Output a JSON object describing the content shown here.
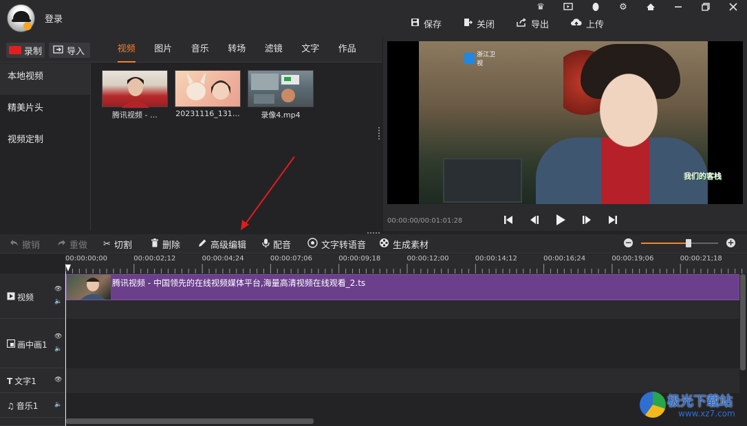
{
  "header": {
    "login_label": "登录",
    "window_controls": [
      "crown-icon",
      "play-screen-icon",
      "penguin-icon",
      "settings-icon",
      "home-icon",
      "minimize-icon",
      "restore-icon",
      "close-icon"
    ],
    "actions": [
      {
        "icon": "save-icon",
        "label": "保存"
      },
      {
        "icon": "exit-icon",
        "label": "关闭"
      },
      {
        "icon": "export-icon",
        "label": "导出"
      },
      {
        "icon": "cloud-upload-icon",
        "label": "上传"
      }
    ]
  },
  "library_bar": {
    "record_label": "录制",
    "import_label": "导入",
    "tabs": [
      "视频",
      "图片",
      "音乐",
      "转场",
      "滤镜",
      "文字",
      "作品"
    ],
    "active_tab": "视频"
  },
  "sidebar": {
    "items": [
      "本地视频",
      "精美片头",
      "视频定制"
    ],
    "active": "本地视频"
  },
  "library": {
    "items": [
      {
        "label": "腾讯视频 - …"
      },
      {
        "label": "20231116_131…"
      },
      {
        "label": "录像4.mp4"
      }
    ]
  },
  "preview": {
    "timecode": "00:00:00/00:01:01:28",
    "channel_logo": "浙江卫视",
    "show_badge": "我们的客栈"
  },
  "toolbar": {
    "undo": "撤销",
    "redo": "重做",
    "cut": "切割",
    "delete": "删除",
    "advanced_edit": "高级编辑",
    "dub": "配音",
    "tts": "文字转语音",
    "generate": "生成素材",
    "zoom_level": 0.62
  },
  "ruler": {
    "labels": [
      "00:00:00;00",
      "00:00:02;12",
      "00:00:04;24",
      "00:00:07;06",
      "00:00:09;18",
      "00:00:12;00",
      "00:00:14;12",
      "00:00:16;24",
      "00:00:19;06",
      "00:00:21;18"
    ]
  },
  "tracks": {
    "video": "视频",
    "pip": "画中画1",
    "text": "文字1",
    "music": "音乐1"
  },
  "clip": {
    "label": "腾讯视频 - 中国领先的在线视频媒体平台,海量高清视频在线观看_2.ts"
  },
  "watermark": {
    "text": "极光下载站",
    "url": "www.xz7.com"
  },
  "colors": {
    "accent": "#ff7e26",
    "clip": "#6b3f8c",
    "record": "#e02020"
  }
}
